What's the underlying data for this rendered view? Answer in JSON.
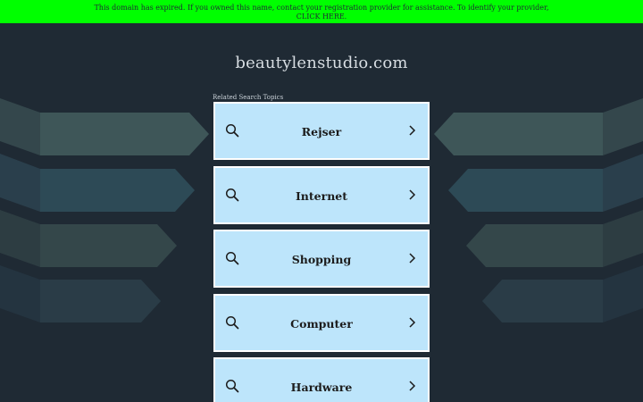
{
  "banner": {
    "line1": "This domain has expired. If you owned this name, contact your registration provider for assistance. To identify your provider,",
    "line2": "CLICK HERE."
  },
  "domain": "beautylenstudio.com",
  "related_label": "Related Search Topics",
  "topics": [
    {
      "label": "Rejser"
    },
    {
      "label": "Internet"
    },
    {
      "label": "Shopping"
    },
    {
      "label": "Computer"
    },
    {
      "label": "Hardware"
    }
  ],
  "colors": {
    "background": "#1f2a34",
    "banner": "#00ff00",
    "card": "#bde5fb",
    "card_border": "#ffffff"
  },
  "icons": {
    "search": "search-icon",
    "chevron": "chevron-right-icon"
  }
}
